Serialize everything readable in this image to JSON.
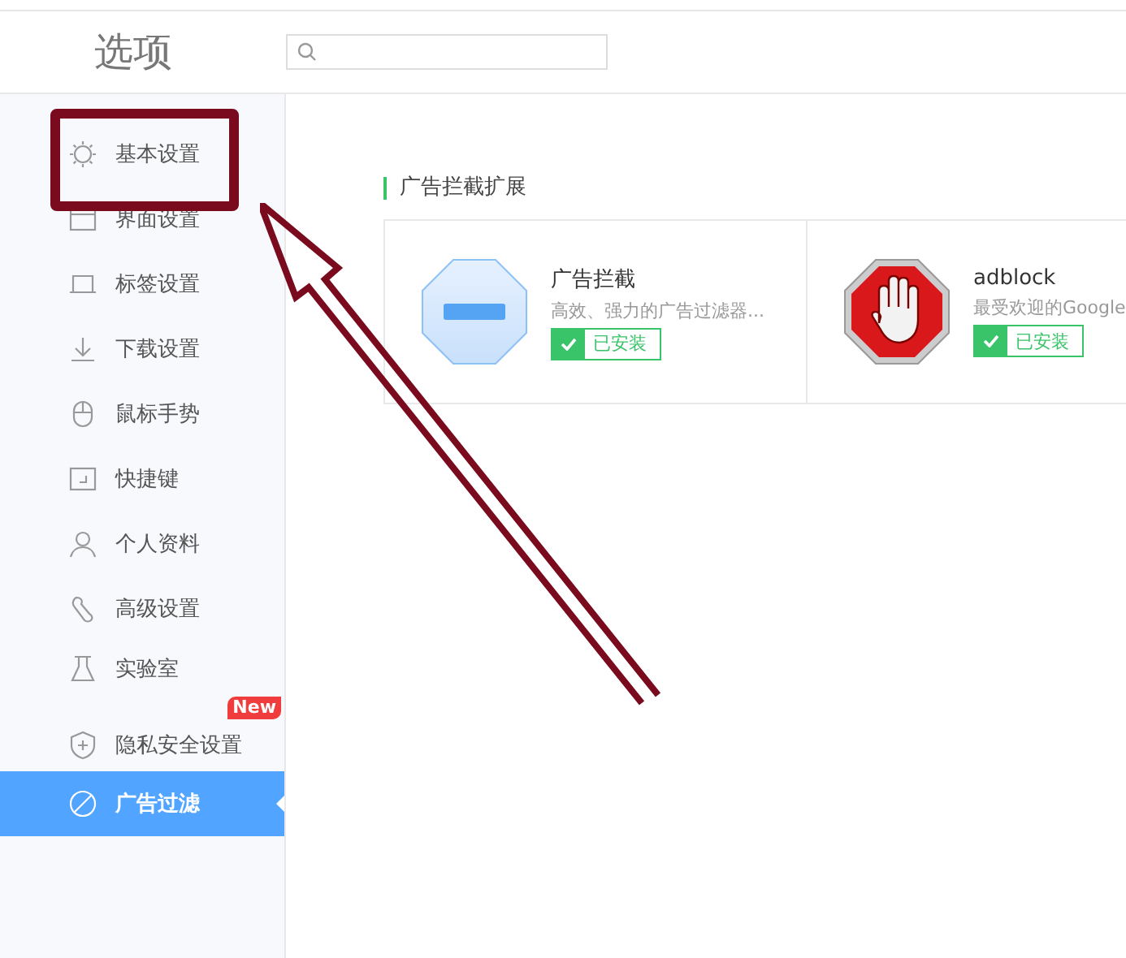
{
  "window": {
    "title": "选项"
  },
  "sidebar": {
    "items": [
      {
        "label": "基本设置",
        "selected": false
      },
      {
        "label": "界面设置",
        "selected": false
      },
      {
        "label": "标签设置",
        "selected": false
      },
      {
        "label": "下载设置",
        "selected": false
      },
      {
        "label": "鼠标手势",
        "selected": false
      },
      {
        "label": "快捷键",
        "selected": false
      },
      {
        "label": "个人资料",
        "selected": false
      },
      {
        "label": "高级设置",
        "selected": false
      },
      {
        "label": "实验室",
        "selected": false
      },
      {
        "label": "隐私安全设置",
        "selected": false,
        "badge": "New"
      },
      {
        "label": "广告过滤",
        "selected": true
      }
    ]
  },
  "section": {
    "title": "广告拦截扩展",
    "extensions": [
      {
        "name": "广告拦截",
        "description": "高效、强力的广告过滤器...",
        "installed": true,
        "status": "已安装"
      },
      {
        "name": "adblock",
        "description": "最受欢迎的Google",
        "installed": true,
        "status": "已安装"
      }
    ]
  }
}
